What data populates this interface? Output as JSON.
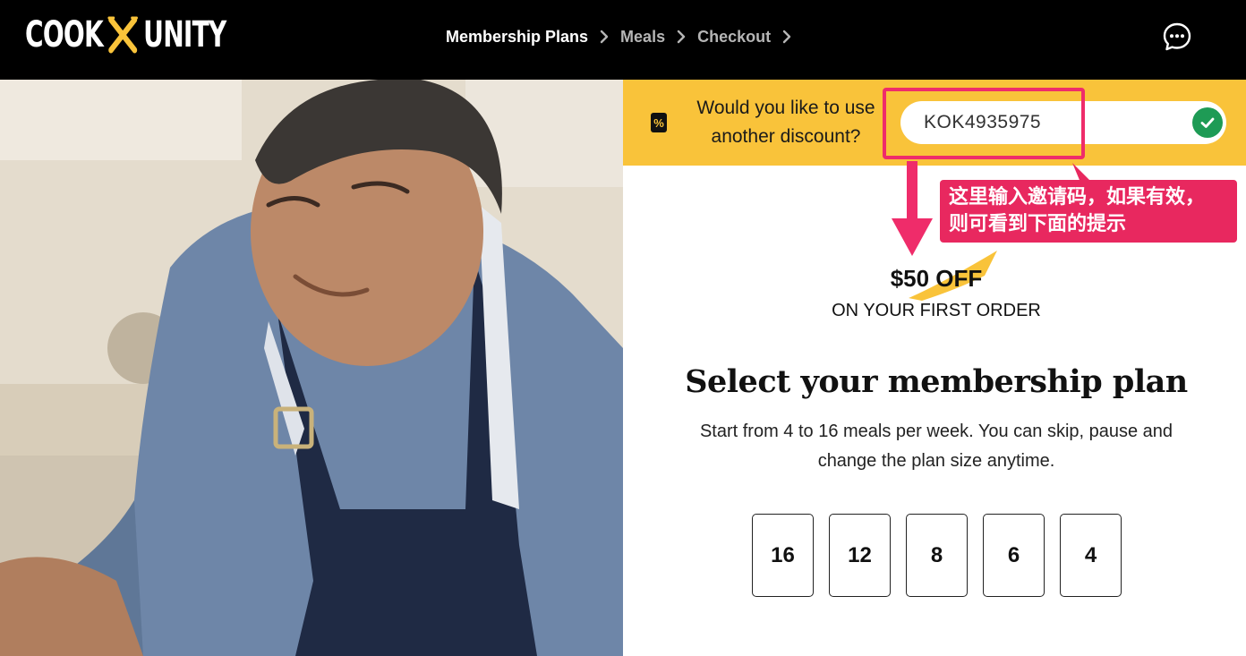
{
  "header": {
    "logo_left": "COOK",
    "logo_right": "UNITY",
    "breadcrumb": [
      {
        "label": "Membership Plans",
        "active": true
      },
      {
        "label": "Meals",
        "active": false
      },
      {
        "label": "Checkout",
        "active": false
      }
    ],
    "chat_icon": "chat-bubble-icon"
  },
  "discount": {
    "percent_icon": "%",
    "question": "Would you like to use another discount?",
    "code_value": "KOK4935975",
    "status_icon": "check-circle-icon",
    "status_color": "#1e9b55",
    "bar_color": "#f9c33a"
  },
  "annotation": {
    "note_line1": "这里输入邀请码，如果有效，",
    "note_line2": "则可看到下面的提示",
    "color": "#e8285f"
  },
  "offer": {
    "amount": "$50 OFF",
    "subtitle": "ON YOUR FIRST ORDER"
  },
  "plan": {
    "title": "Select your membership plan",
    "description": "Start from 4 to 16 meals per week. You can skip, pause and change the plan size anytime.",
    "options": [
      "16",
      "12",
      "8",
      "6",
      "4"
    ]
  }
}
